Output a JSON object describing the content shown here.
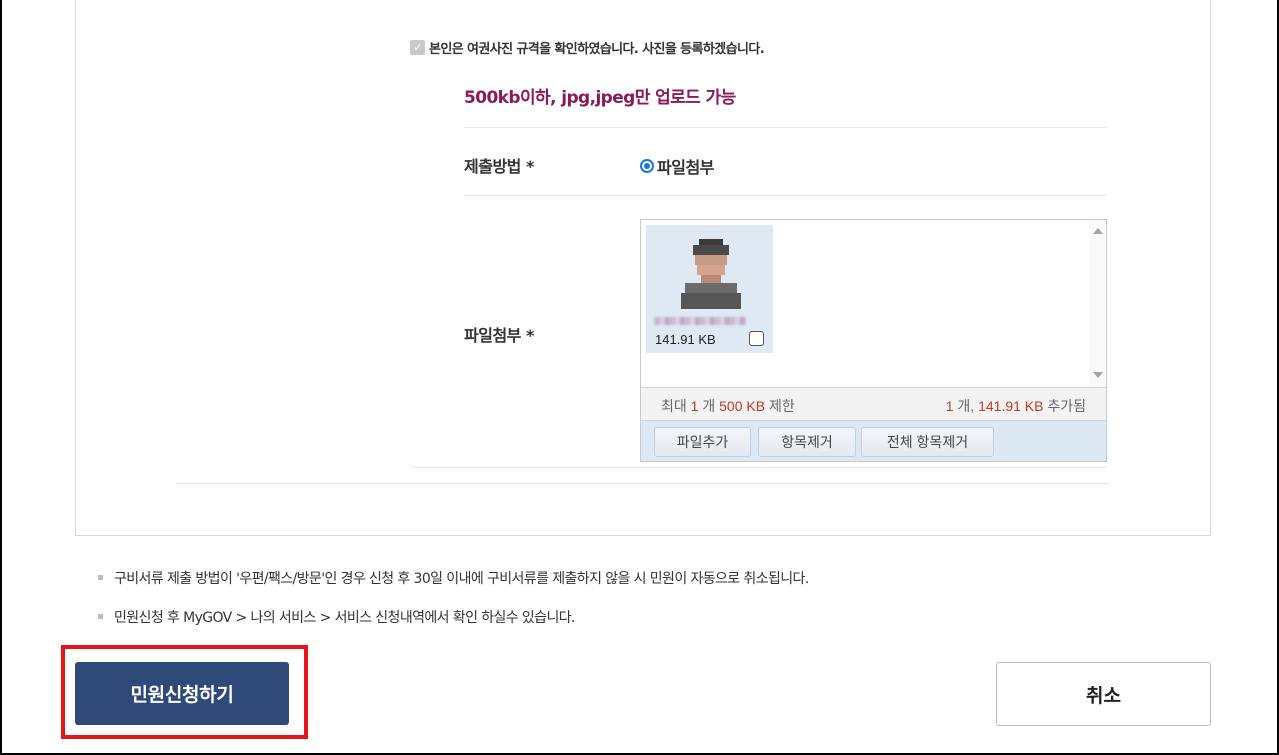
{
  "form": {
    "consent_text": "본인은 여권사진 규격을 확인하였습니다. 사진을 등록하겠습니다.",
    "consent_checked": true,
    "upload_notice": "500kb이하, jpg,jpeg만 업로드 가능",
    "submit_method_label": "제출방법 *",
    "submit_method_option": "파일첨부",
    "attachment_label": "파일첨부 *"
  },
  "uploader": {
    "file_size": "141.91 KB",
    "limit_prefix": "최대",
    "limit_count": "1",
    "limit_count_unit": "개",
    "limit_size": "500 KB",
    "limit_suffix": "제한",
    "added_count": "1",
    "added_count_unit": "개,",
    "added_size": "141.91 KB",
    "added_suffix": "추가됨",
    "buttons": {
      "add": "파일추가",
      "remove": "항목제거",
      "remove_all": "전체 항목제거"
    }
  },
  "notes": [
    "구비서류 제출 방법이 '우편/팩스/방문'인 경우 신청 후 30일 이내에 구비서류를 제출하지 않을 시 민원이 자동으로 취소됩니다.",
    "민원신청 후 MyGOV > 나의 서비스 > 서비스 신청내역에서 확인 하실수 있습니다."
  ],
  "actions": {
    "apply": "민원신청하기",
    "cancel": "취소"
  },
  "colors": {
    "notice": "#8b1a5a",
    "apply_button": "#2f4a78",
    "highlight": "#e8141a",
    "radio": "#1a73e8"
  }
}
